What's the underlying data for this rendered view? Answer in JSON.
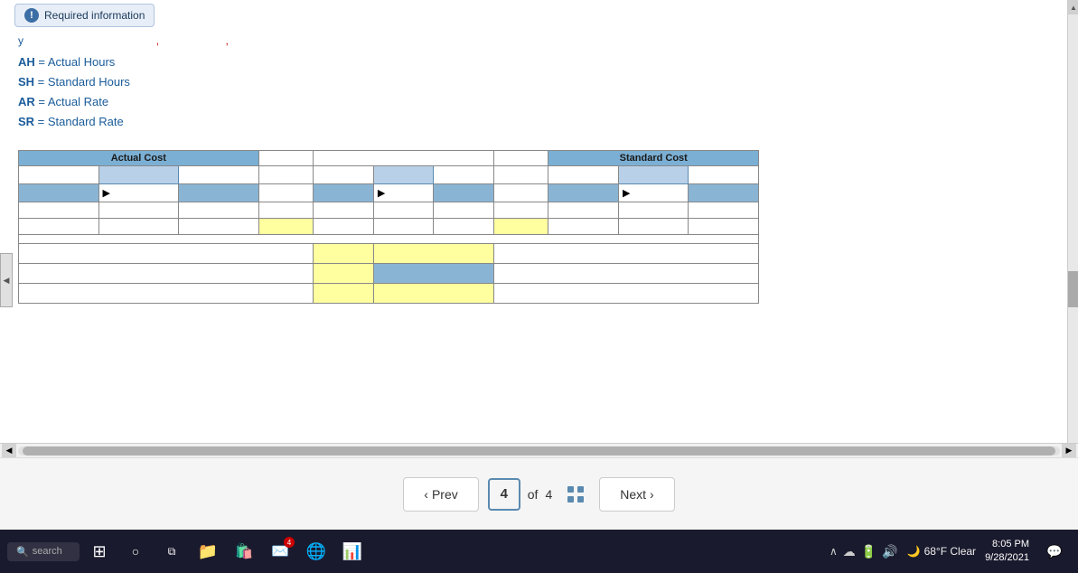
{
  "badge": {
    "icon": "!",
    "label": "Required information"
  },
  "top_line": {
    "text": "y                                                              ,                    ,"
  },
  "abbreviations": [
    {
      "abbrev": "AH",
      "full": "Actual Hours"
    },
    {
      "abbrev": "SH",
      "full": "Standard Hours"
    },
    {
      "abbrev": "AR",
      "full": "Actual Rate"
    },
    {
      "abbrev": "SR",
      "full": "Standard Rate"
    }
  ],
  "diagram": {
    "actual_cost_label": "Actual Cost",
    "standard_cost_label": "Standard Cost"
  },
  "navigation": {
    "prev_label": "Prev",
    "next_label": "Next",
    "current_page": "4",
    "of_label": "of",
    "total_pages": "4"
  },
  "taskbar": {
    "search_placeholder": "search",
    "weather": "68°F  Clear",
    "time": "8:05 PM",
    "date": "9/28/2021"
  }
}
